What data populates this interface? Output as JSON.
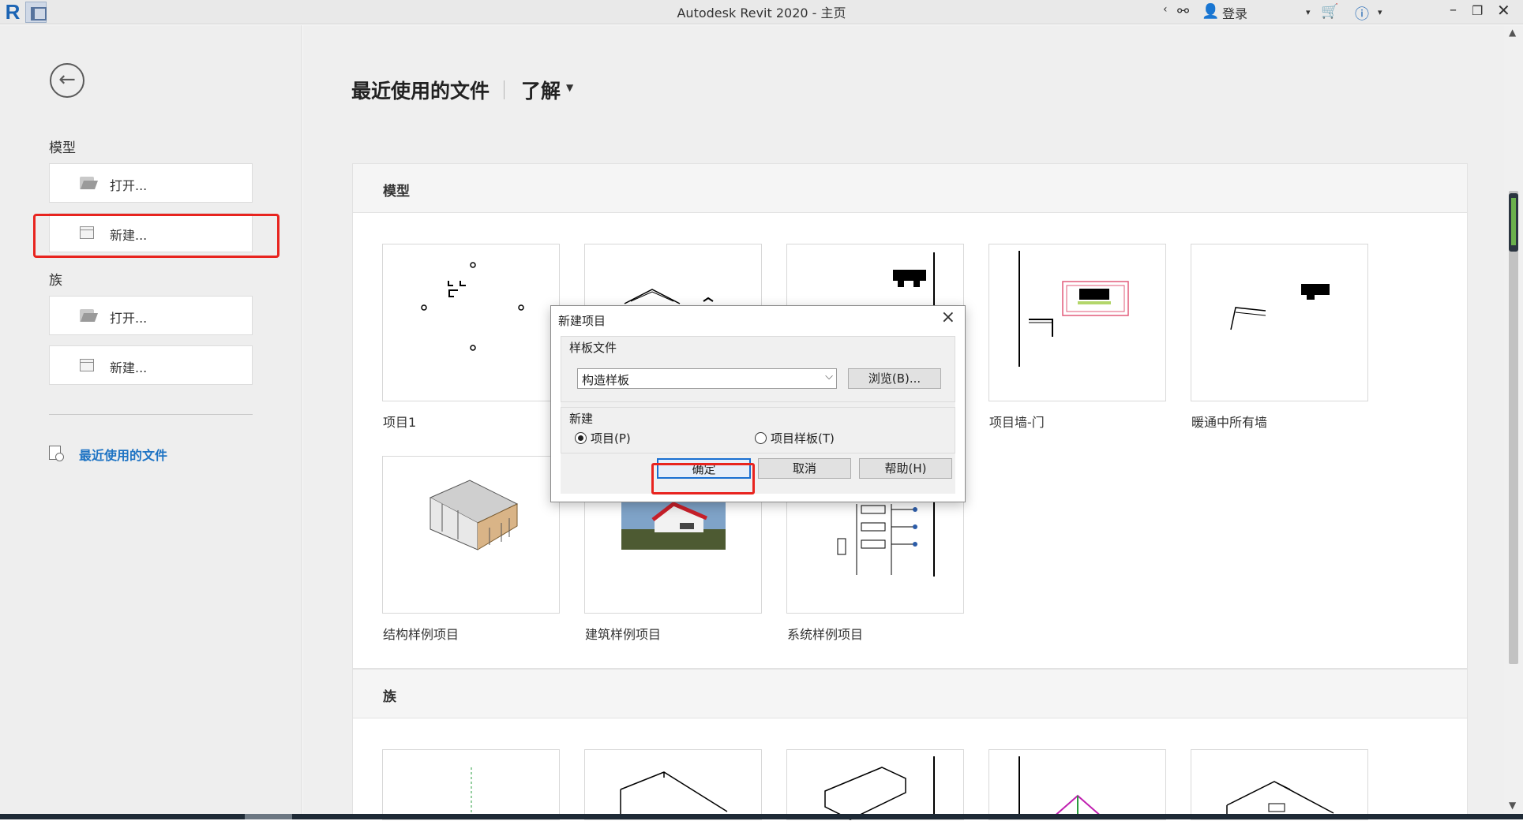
{
  "window": {
    "title": "Autodesk Revit 2020 - 主页",
    "sign_in": "登录"
  },
  "sidebar": {
    "model_heading": "模型",
    "model_open": "打开...",
    "model_new": "新建...",
    "family_heading": "族",
    "family_open": "打开...",
    "family_new": "新建...",
    "recent_link": "最近使用的文件"
  },
  "main": {
    "tab_recent": "最近使用的文件",
    "tab_learn": "了解",
    "models_section": {
      "title": "模型",
      "items": [
        "项目1",
        "",
        "",
        "项目墙-门",
        "暖通中所有墙",
        "结构样例项目",
        "建筑样例项目",
        "系统样例项目"
      ]
    },
    "families_section": {
      "title": "族"
    }
  },
  "dialog": {
    "title": "新建项目",
    "template_group": "样板文件",
    "template_value": "构造样板",
    "browse": "浏览(B)...",
    "new_group": "新建",
    "radio_project": "项目(P)",
    "radio_template": "项目样板(T)",
    "selected": "项目",
    "ok": "确定",
    "cancel": "取消",
    "help": "帮助(H)"
  },
  "colors": {
    "highlight": "#e8241f",
    "link": "#1f74c4"
  }
}
